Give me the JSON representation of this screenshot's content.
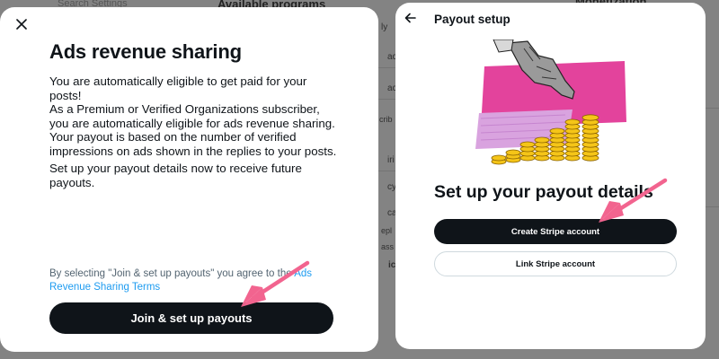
{
  "background": {
    "search_placeholder": "Search Settings",
    "programs_heading": "Available programs",
    "monetization_heading": "Monetization",
    "fragments": [
      "ly",
      "ac",
      "ac",
      "crib",
      "iri",
      "cy",
      "ca",
      "epl",
      "ass",
      "ic"
    ]
  },
  "left_modal": {
    "title": "Ads revenue sharing",
    "paragraphs": [
      "You are automatically eligible to get paid for your posts!",
      "As a Premium or Verified Organizations subscriber, you are automatically eligible for ads revenue sharing. Your payout is based on the number of verified impressions on ads shown in the replies to your posts.",
      "Set up your payout details now to receive future payouts."
    ],
    "legal_prefix": "By selecting \"Join & set up payouts\" you agree to the ",
    "legal_link": "Ads Revenue Sharing Terms",
    "join_button": "Join & set up payouts",
    "close_icon": "close-icon"
  },
  "right_modal": {
    "header": "Payout setup",
    "back_icon": "back-arrow-icon",
    "heading": "Set up your payout details",
    "create_button": "Create Stripe account",
    "link_button": "Link Stripe account"
  },
  "colors": {
    "accent_link": "#1d9bf0",
    "primary_button": "#0f1419",
    "annotation_arrow": "#f2648f",
    "illustration_pink": "#e3439c",
    "coin_gold": "#f5c518"
  }
}
